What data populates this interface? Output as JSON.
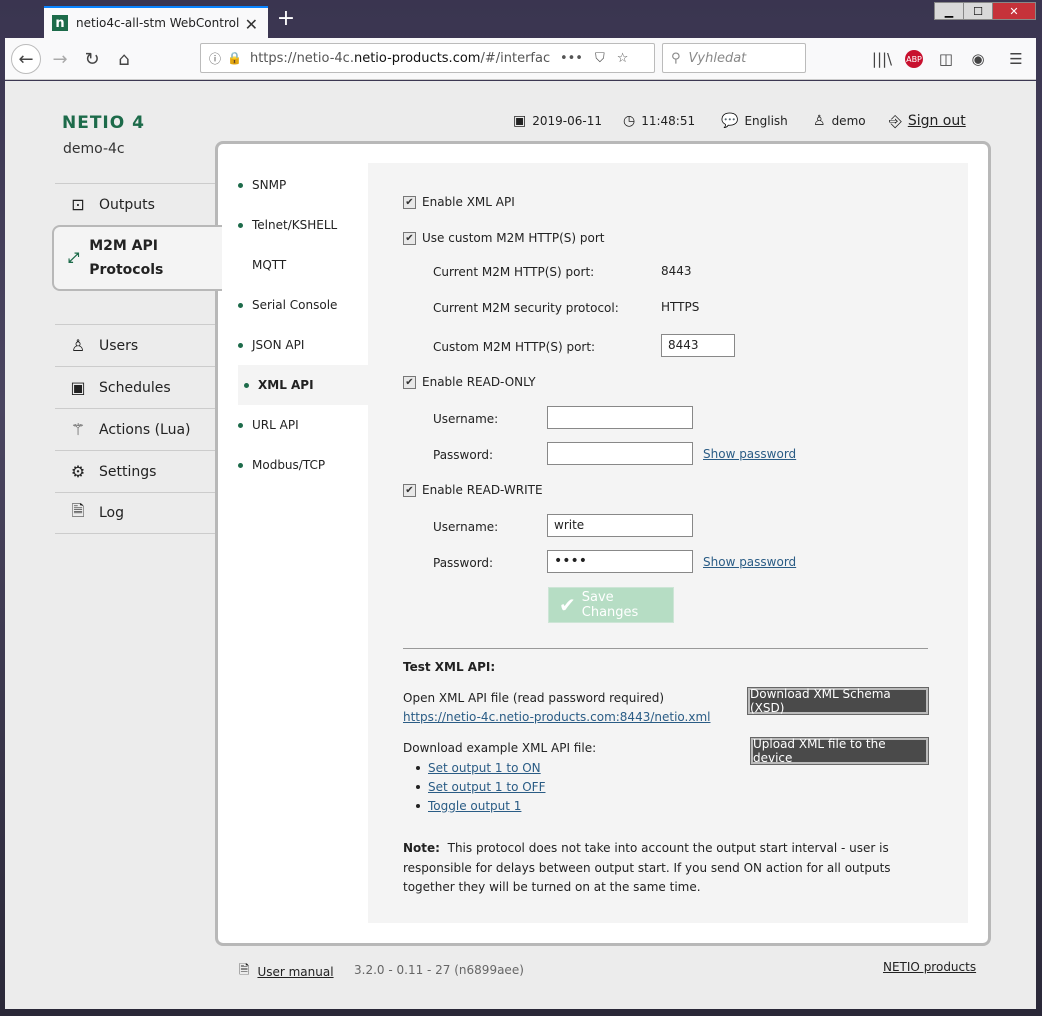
{
  "browser": {
    "tab_title": "netio4c-all-stm WebControl",
    "tab_favicon": "n",
    "url_prefix": "https://netio-4c.",
    "url_domain": "netio-products.com",
    "url_suffix": "/#/interfac",
    "search_placeholder": "Vyhledat"
  },
  "header": {
    "logo": "NETIO 4",
    "device_name": "demo-4c",
    "date": "2019-06-11",
    "time": "11:48:51",
    "language": "English",
    "user": "demo",
    "signout": "Sign out"
  },
  "sidebar": {
    "items": [
      {
        "label": "Outputs",
        "icon": "outputs-icon"
      },
      {
        "label": "M2M API Protocols",
        "icon": "m2m-icon"
      },
      {
        "label": "Users",
        "icon": "user-icon"
      },
      {
        "label": "Schedules",
        "icon": "calendar-icon"
      },
      {
        "label": "Actions (Lua)",
        "icon": "wand-icon"
      },
      {
        "label": "Settings",
        "icon": "gear-icon"
      },
      {
        "label": "Log",
        "icon": "document-icon"
      }
    ],
    "active_line1": "M2M API",
    "active_line2": "Protocols"
  },
  "subnav": {
    "items": [
      "SNMP",
      "Telnet/KSHELL",
      "MQTT",
      "Serial Console",
      "JSON API",
      "XML API",
      "URL API",
      "Modbus/TCP"
    ]
  },
  "form": {
    "enable_xml_api": "Enable XML API",
    "use_custom_port": "Use custom M2M HTTP(S) port",
    "current_port_label": "Current M2M HTTP(S) port:",
    "current_port_value": "8443",
    "current_protocol_label": "Current M2M security protocol:",
    "current_protocol_value": "HTTPS",
    "custom_port_label": "Custom M2M HTTP(S) port:",
    "custom_port_value": "8443",
    "enable_read_only": "Enable READ-ONLY",
    "ro_username_label": "Username:",
    "ro_username_value": "",
    "ro_password_label": "Password:",
    "ro_password_value": "",
    "show_password": "Show password",
    "enable_read_write": "Enable READ-WRITE",
    "rw_username_label": "Username:",
    "rw_username_value": "write",
    "rw_password_label": "Password:",
    "rw_password_value": "••••",
    "save_changes": "Save Changes"
  },
  "test": {
    "heading": "Test XML API:",
    "open_file_text": "Open XML API file (read password required)",
    "file_link": "https://netio-4c.netio-products.com:8443/netio.xml",
    "download_xsd": "Download XML Schema (XSD)",
    "download_example": "Download example XML API file:",
    "upload_xml": "Upload XML file to the device",
    "examples": [
      "Set output 1 to ON",
      "Set output 1 to OFF",
      "Toggle output 1"
    ],
    "note_label": "Note:",
    "note_text": "This protocol does not take into account the output start interval - user is responsible for delays between output start. If you send ON action for all outputs together they will be turned on at the same time."
  },
  "footer": {
    "manual": "User manual",
    "version": "3.2.0 - 0.11 - 27 (n6899aee)",
    "netio_link": "NETIO products"
  }
}
